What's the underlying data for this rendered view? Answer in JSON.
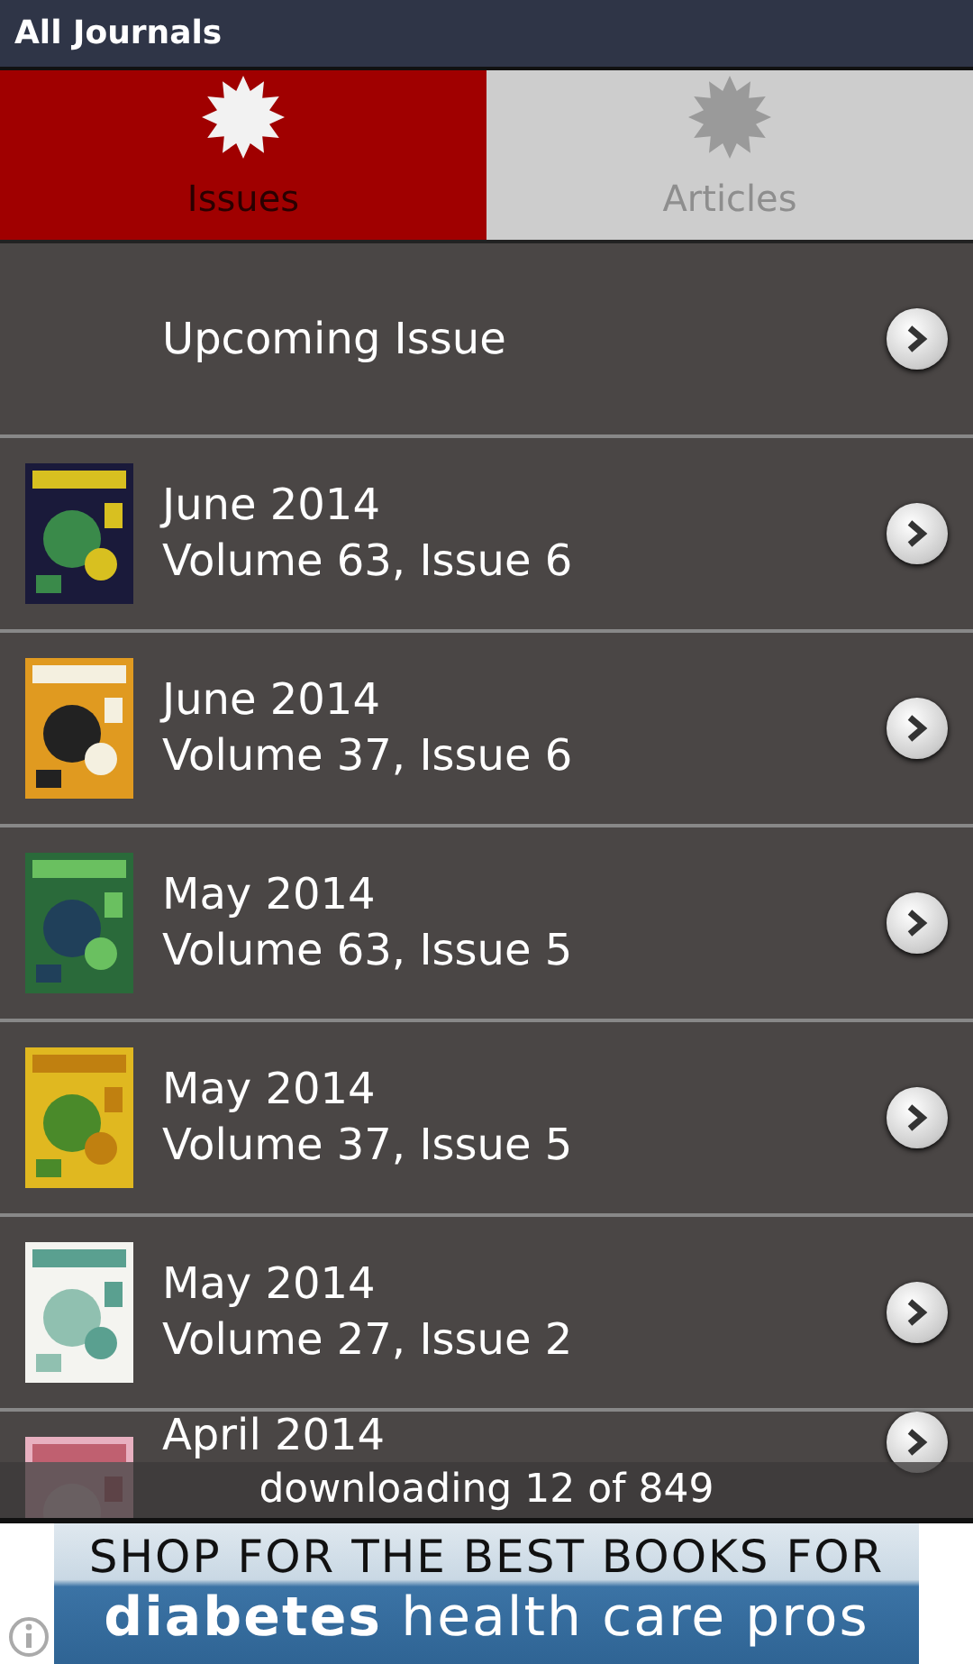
{
  "title_bar": {
    "title": "All Journals"
  },
  "tabs": [
    {
      "label": "Issues",
      "selected": true
    },
    {
      "label": "Articles",
      "selected": false
    }
  ],
  "issues": [
    {
      "kind": "upcoming",
      "title": "Upcoming Issue"
    },
    {
      "kind": "issue",
      "title": "June 2014",
      "subtitle": "Volume 63, Issue 6"
    },
    {
      "kind": "issue",
      "title": "June 2014",
      "subtitle": "Volume 37, Issue 6"
    },
    {
      "kind": "issue",
      "title": "May 2014",
      "subtitle": "Volume 63, Issue 5"
    },
    {
      "kind": "issue",
      "title": "May 2014",
      "subtitle": "Volume 37, Issue 5"
    },
    {
      "kind": "issue",
      "title": "May 2014",
      "subtitle": "Volume 27, Issue 2"
    },
    {
      "kind": "issue",
      "title": "April 2014"
    }
  ],
  "status": {
    "text": "downloading 12 of 849"
  },
  "ad": {
    "line_1": "SHOP FOR THE BEST BOOKS FOR",
    "line_2": "**diabetes** health care pros"
  }
}
